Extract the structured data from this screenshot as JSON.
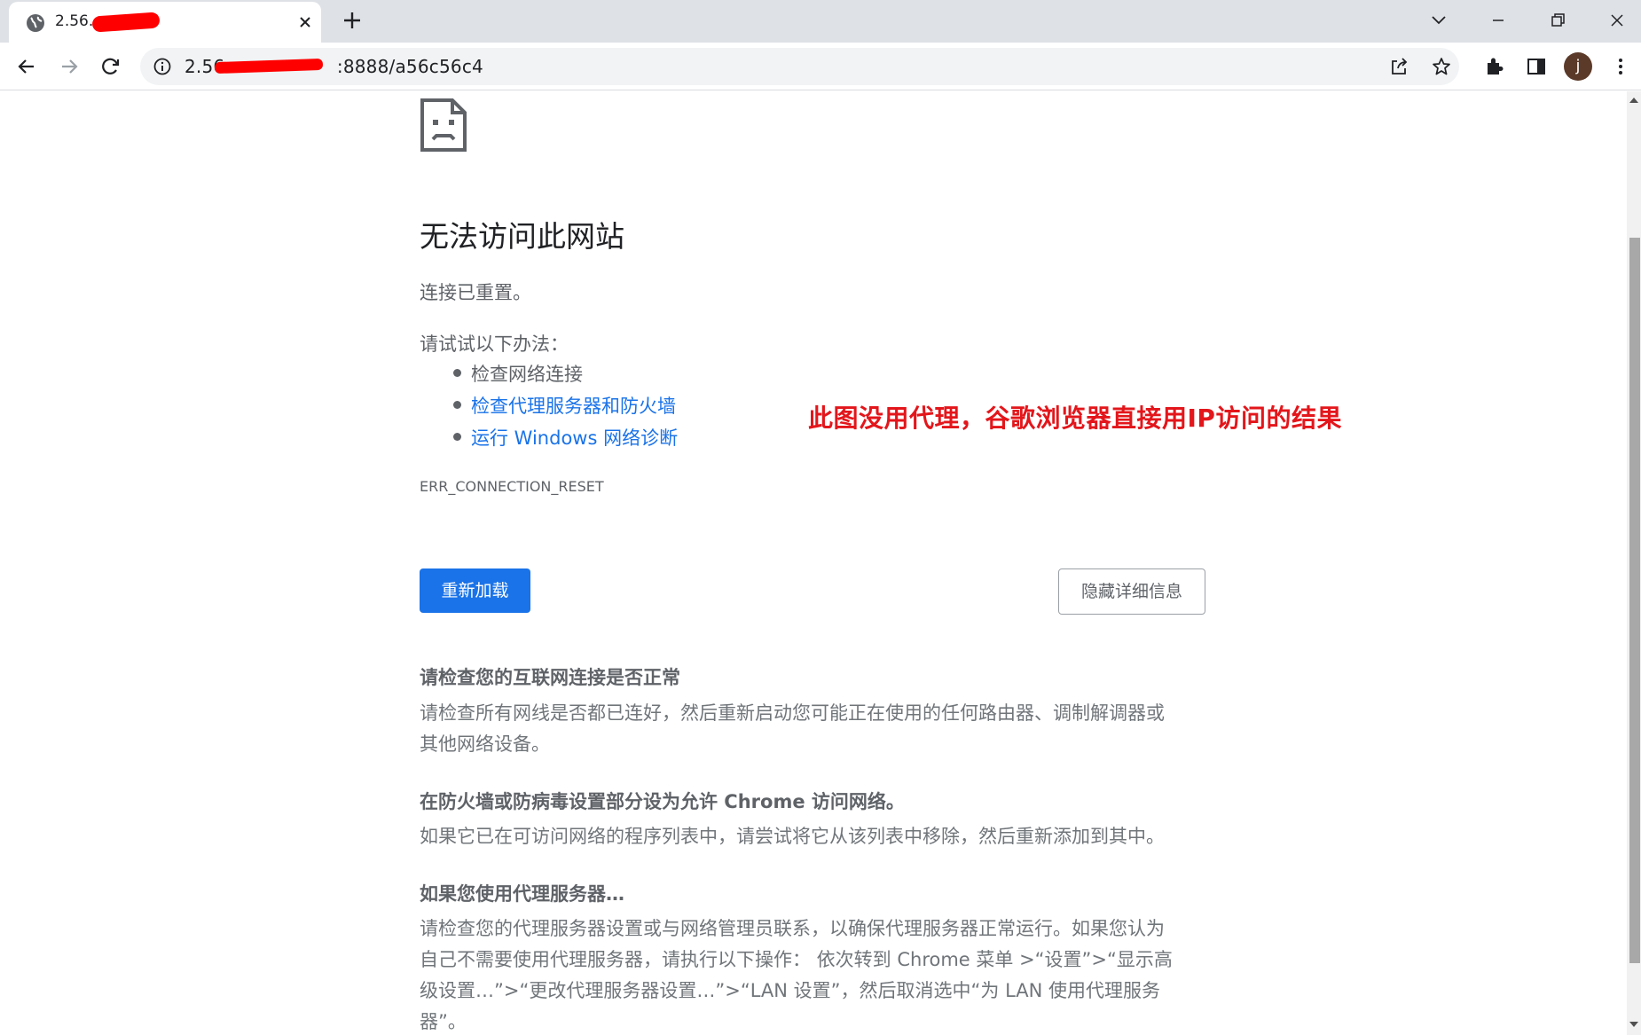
{
  "tab": {
    "title": "2.56.",
    "favicon": "globe-icon",
    "close": "close-icon"
  },
  "window_controls": [
    "chevron-down-icon",
    "minimize-icon",
    "restore-icon",
    "close-icon"
  ],
  "address_bar": {
    "url_prefix": "2.56.",
    "url_suffix": ":8888/a56c56c4",
    "security_icon": "info-icon"
  },
  "toolbar_icons": [
    "share-icon",
    "star-icon",
    "extensions-icon",
    "side-panel-icon",
    "menu-icon"
  ],
  "profile": {
    "initial": "j",
    "color": "#5b3a29"
  },
  "error": {
    "heading": "无法访问此网站",
    "message": "连接已重置。",
    "try_label": "请试试以下办法：",
    "suggestions": [
      {
        "text": "检查网络连接",
        "link": false
      },
      {
        "text": "检查代理服务器和防火墙",
        "link": true
      },
      {
        "text": "运行 Windows 网络诊断",
        "link": true
      }
    ],
    "code": "ERR_CONNECTION_RESET"
  },
  "annotation": "此图没用代理，谷歌浏览器直接用IP访问的结果",
  "buttons": {
    "reload": "重新加载",
    "details": "隐藏详细信息"
  },
  "details": [
    {
      "heading": "请检查您的互联网连接是否正常",
      "lines": [
        "请检查所有网线是否都已连好，然后重新启动您可能正在使用的任何路由器、调制解调器或",
        "其他网络设备。"
      ]
    },
    {
      "heading": "在防火墙或防病毒设置部分设为允许 Chrome 访问网络。",
      "lines": [
        "如果它已在可访问网络的程序列表中，请尝试将它从该列表中移除，然后重新添加到其中。"
      ]
    },
    {
      "heading": "如果您使用代理服务器…",
      "lines": [
        "请检查您的代理服务器设置或与网络管理员联系，以确保代理服务器正常运行。如果您认为",
        "自己不需要使用代理服务器，请执行以下操作： 依次转到 Chrome 菜单 >“设置”>“显示高",
        "级设置…”>“更改代理服务器设置…”>“LAN 设置”，然后取消选中“为 LAN 使用代理服务",
        "器”。"
      ]
    }
  ],
  "colors": {
    "link": "#1a73e8",
    "primary_button": "#1a73e8",
    "annotation": "#e3161b",
    "redaction": "#ff0000"
  }
}
